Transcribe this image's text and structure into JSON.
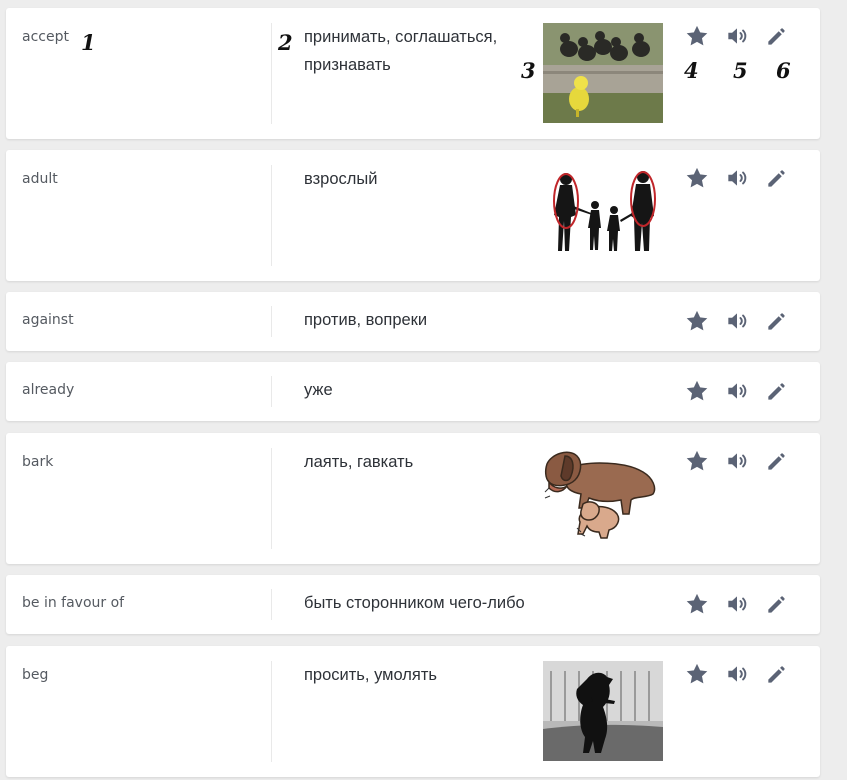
{
  "colors": {
    "background": "#ededed",
    "card": "#ffffff",
    "icon": "#5b6375",
    "word_text": "#555a61",
    "translation_text": "#2e3238"
  },
  "icons": {
    "favorite": "star-icon",
    "pronounce": "speaker-icon",
    "edit": "pencil-icon"
  },
  "callouts": [
    "1",
    "2",
    "3",
    "4",
    "5",
    "6"
  ],
  "words": [
    {
      "word": "accept",
      "translation": "принимать, соглашаться, признавать",
      "image": "ducklings"
    },
    {
      "word": "adult",
      "translation": "взрослый",
      "image": "family-silhouette"
    },
    {
      "word": "against",
      "translation": "против, вопреки",
      "image": null
    },
    {
      "word": "already",
      "translation": "уже",
      "image": null
    },
    {
      "word": "bark",
      "translation": "лаять, гавкать",
      "image": "barking-dogs"
    },
    {
      "word": "be in favour of",
      "translation": "быть сторонником чего-либо",
      "image": null
    },
    {
      "word": "beg",
      "translation": "просить, умолять",
      "image": "begging-dog"
    }
  ]
}
